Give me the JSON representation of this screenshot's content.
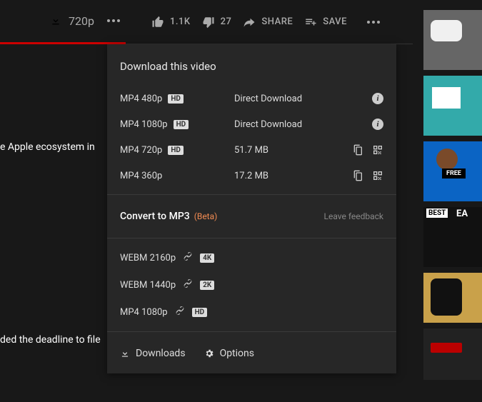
{
  "actionbar": {
    "quality": "720p",
    "likes": "1.1K",
    "dislikes": "27",
    "share": "SHARE",
    "save": "SAVE"
  },
  "bg": {
    "line1": "e Apple ecosystem in",
    "line2": "ded the deadline to file"
  },
  "panel": {
    "title": "Download this video",
    "rows": [
      {
        "fmt": "MP4 480p",
        "badge": "HD",
        "meta": "Direct Download",
        "icons": "info"
      },
      {
        "fmt": "MP4 1080p",
        "badge": "HD",
        "meta": "Direct Download",
        "icons": "info"
      },
      {
        "fmt": "MP4 720p",
        "badge": "HD",
        "meta": "51.7 MB",
        "icons": "copyqr"
      },
      {
        "fmt": "MP4 360p",
        "badge": "",
        "meta": "17.2 MB",
        "icons": "copyqr"
      }
    ],
    "convert": {
      "label": "Convert to MP3",
      "beta": "(Beta)",
      "feedback": "Leave feedback"
    },
    "extras": [
      {
        "fmt": "WEBM 2160p",
        "badge": "4K"
      },
      {
        "fmt": "WEBM 1440p",
        "badge": "2K"
      },
      {
        "fmt": "MP4 1080p",
        "badge": "HD"
      }
    ],
    "footer": {
      "downloads": "Downloads",
      "options": "Options"
    }
  }
}
